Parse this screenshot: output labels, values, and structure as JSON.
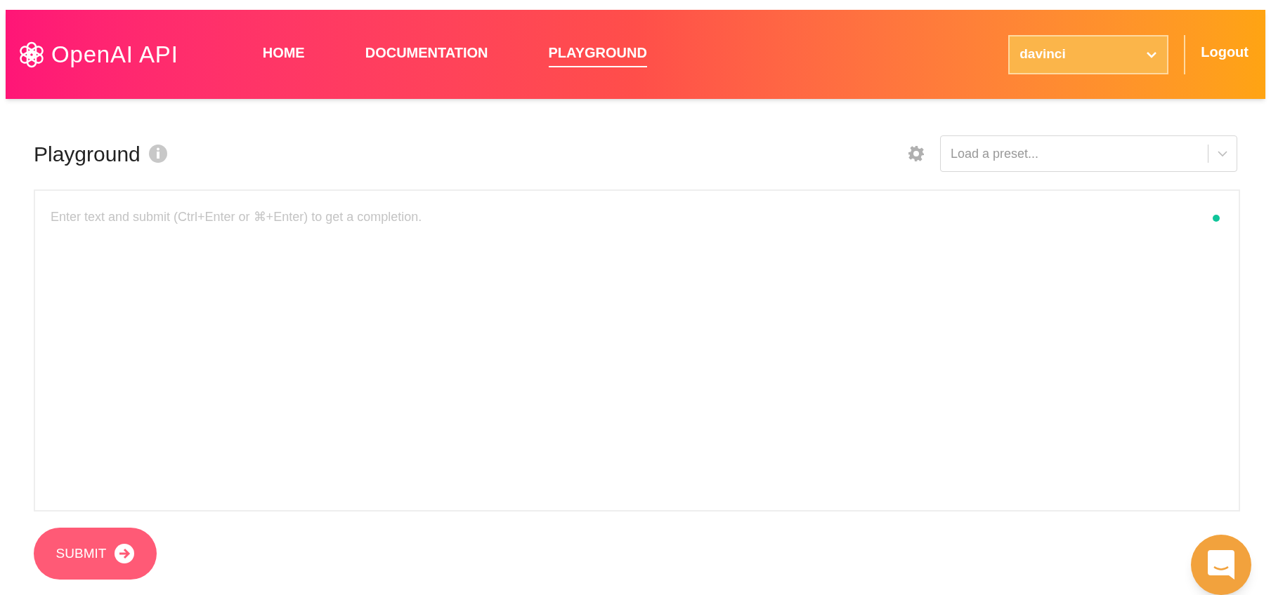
{
  "header": {
    "brand": "OpenAI API",
    "nav": [
      {
        "label": "HOME",
        "selected": false
      },
      {
        "label": "DOCUMENTATION",
        "selected": false
      },
      {
        "label": "PLAYGROUND",
        "selected": true
      }
    ],
    "model_select": {
      "value": "davinci"
    },
    "logout": "Logout"
  },
  "page": {
    "title": "Playground",
    "preset_select": {
      "placeholder": "Load a preset..."
    },
    "prompt": {
      "placeholder": "Enter text and submit (Ctrl+Enter or ⌘+Enter) to get a completion."
    },
    "submit": "SUBMIT"
  }
}
